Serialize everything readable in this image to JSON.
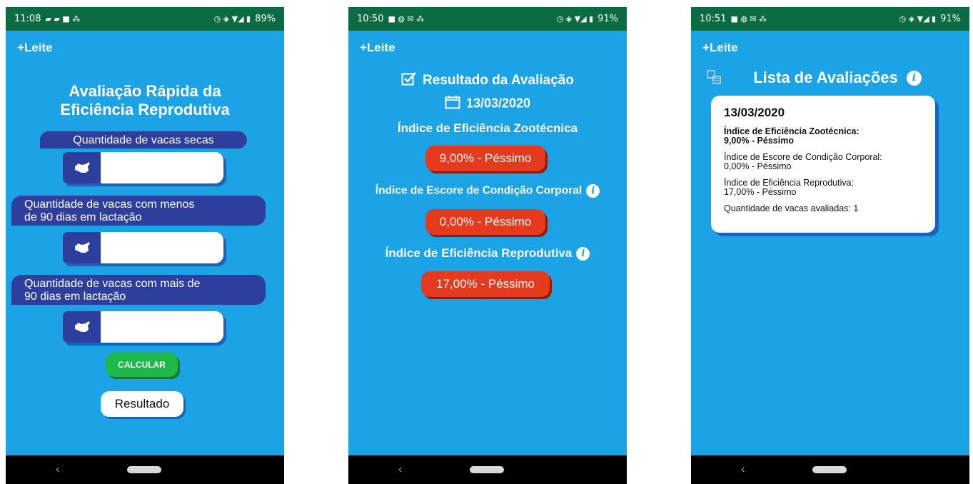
{
  "app_title": "+Leite",
  "screens": [
    {
      "status": {
        "time": "11:08",
        "battery": "89%"
      },
      "title_line1": "Avaliação Rápida da",
      "title_line2": "Eficiência Reprodutiva",
      "fields": [
        {
          "label_line1": "Quantidade de vacas secas",
          "label_line2": "",
          "value": ""
        },
        {
          "label_line1": "Quantidade de vacas com menos",
          "label_line2": "de 90 dias em lactação",
          "value": ""
        },
        {
          "label_line1": "Quantidade de vacas com mais de",
          "label_line2": "90 dias em lactação",
          "value": ""
        }
      ],
      "calc_button": "CALCULAR",
      "result_button": "Resultado"
    },
    {
      "status": {
        "time": "10:50",
        "battery": "91%"
      },
      "heading": "Resultado da Avaliação",
      "date": "13/03/2020",
      "indices": [
        {
          "label": "Índice de Eficiência Zootécnica",
          "value": "9,00% - Péssimo",
          "info": false
        },
        {
          "label": "Índice de Escore de Condição Corporal",
          "value": "0,00% - Péssimo",
          "info": true
        },
        {
          "label": "Índice de Eficiência Reprodutiva",
          "value": "17,00% - Péssimo",
          "info": true
        }
      ]
    },
    {
      "status": {
        "time": "10:51",
        "battery": "91%"
      },
      "heading": "Lista de Avaliações",
      "card": {
        "date": "13/03/2020",
        "zoo_label": "Índice de Eficiência Zootécnica:",
        "zoo_value": "9,00% - Péssimo",
        "ecc_label": "Índice de Escore de Condição Corporal:",
        "ecc_value": "0,00% - Péssimo",
        "rep_label": "Índice de Eficiência Reprodutiva:",
        "rep_value": "17,00% - Péssimo",
        "count": "Quantidade de vacas avaliadas: 1"
      }
    }
  ],
  "colors": {
    "background": "#1ca3e6",
    "statusbar": "#0b6b42",
    "label": "#2e3e9c",
    "bad": "#e53a1d",
    "calc": "#1fb84b"
  },
  "icons": [
    "cow-icon",
    "checkbox-icon",
    "calendar-icon",
    "info-icon",
    "list-icon"
  ]
}
